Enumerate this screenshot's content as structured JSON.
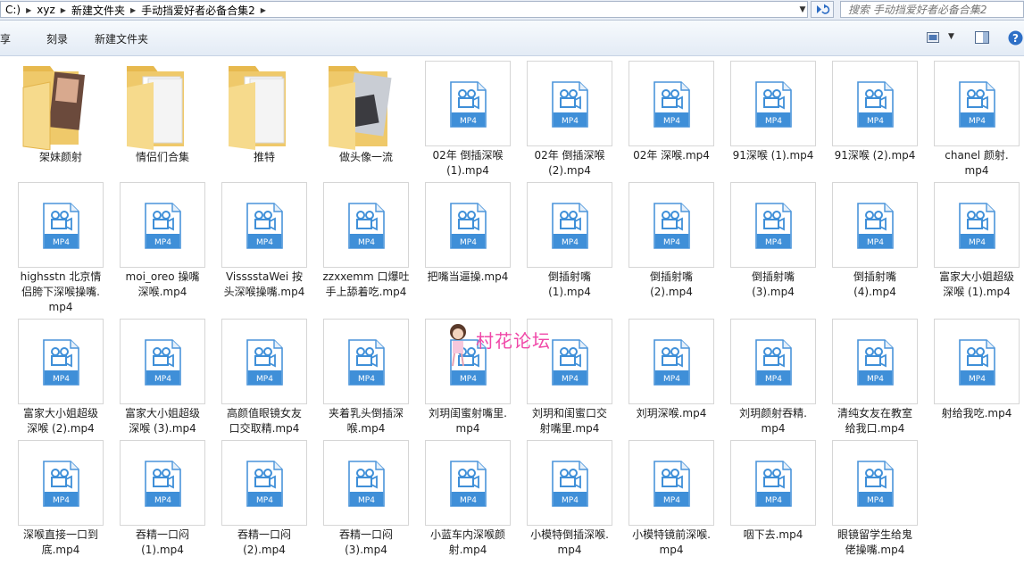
{
  "address": {
    "breadcrumbs": [
      "C:)",
      "xyz",
      "新建文件夹",
      "手动挡爱好者必备合集2"
    ],
    "search_placeholder": "搜索 手动挡爱好者必备合集2"
  },
  "toolbar": {
    "share_label": "享",
    "burn_label": "刻录",
    "new_folder_label": "新建文件夹"
  },
  "file_type_label": "MP4",
  "icons": {
    "refresh": "refresh-icon",
    "view": "view-options-icon",
    "preview_pane": "preview-pane-icon",
    "help": "help-icon",
    "video_file": "video-file-icon",
    "folder": "folder-icon"
  },
  "colors": {
    "mp4_icon_blue": "#3f8fd8",
    "folder_yellow": "#f4d27a",
    "watermark_pink": "#f048a8"
  },
  "folders": [
    {
      "name": "架妹颜射",
      "lines": [
        "架妹颜射"
      ]
    },
    {
      "name": "情侣们合集",
      "lines": [
        "情侣们合集"
      ]
    },
    {
      "name": "推特",
      "lines": [
        "推特"
      ]
    },
    {
      "name": "做头像一流",
      "lines": [
        "做头像一流"
      ]
    }
  ],
  "files_row1": [
    {
      "lines": [
        "02年 倒插深喉",
        "(1).mp4"
      ]
    },
    {
      "lines": [
        "02年 倒插深喉",
        "(2).mp4"
      ]
    },
    {
      "lines": [
        "02年 深喉.mp4"
      ]
    },
    {
      "lines": [
        "91深喉 (1).mp4"
      ]
    },
    {
      "lines": [
        "91深喉 (2).mp4"
      ]
    },
    {
      "lines": [
        "chanel 颜射.",
        "mp4"
      ]
    }
  ],
  "files_row2": [
    {
      "lines": [
        "highsstn 北京情",
        "侣胯下深喉操嘴.",
        "mp4"
      ]
    },
    {
      "lines": [
        "moi_oreo 操嘴",
        "深喉.mp4"
      ]
    },
    {
      "lines": [
        "VisssstaWei 按",
        "头深喉操嘴.mp4"
      ]
    },
    {
      "lines": [
        "zzxxemm 口爆吐",
        "手上舔着吃.mp4"
      ]
    },
    {
      "lines": [
        "把嘴当逼操.mp4"
      ]
    },
    {
      "lines": [
        "倒插射嘴",
        "(1).mp4"
      ]
    },
    {
      "lines": [
        "倒插射嘴",
        "(2).mp4"
      ]
    },
    {
      "lines": [
        "倒插射嘴",
        "(3).mp4"
      ]
    },
    {
      "lines": [
        "倒插射嘴",
        "(4).mp4"
      ]
    },
    {
      "lines": [
        "富家大小姐超级",
        "深喉 (1).mp4"
      ]
    }
  ],
  "files_row3": [
    {
      "lines": [
        "富家大小姐超级",
        "深喉 (2).mp4"
      ]
    },
    {
      "lines": [
        "富家大小姐超级",
        "深喉 (3).mp4"
      ]
    },
    {
      "lines": [
        "高颜值眼镜女友",
        "口交取精.mp4"
      ]
    },
    {
      "lines": [
        "夹着乳头倒插深",
        "喉.mp4"
      ]
    },
    {
      "lines": [
        "刘玥闺蜜射嘴里.",
        "mp4"
      ]
    },
    {
      "lines": [
        "刘玥和闺蜜口交",
        "射嘴里.mp4"
      ]
    },
    {
      "lines": [
        "刘玥深喉.mp4"
      ]
    },
    {
      "lines": [
        "刘玥颜射吞精.",
        "mp4"
      ]
    },
    {
      "lines": [
        "清纯女友在教室",
        "给我口.mp4"
      ]
    },
    {
      "lines": [
        "射给我吃.mp4"
      ]
    }
  ],
  "files_row4": [
    {
      "lines": [
        "深喉直接一口到",
        "底.mp4"
      ]
    },
    {
      "lines": [
        "吞精一口闷",
        "(1).mp4"
      ]
    },
    {
      "lines": [
        "吞精一口闷",
        "(2).mp4"
      ]
    },
    {
      "lines": [
        "吞精一口闷",
        "(3).mp4"
      ]
    },
    {
      "lines": [
        "小蓝车内深喉颜",
        "射.mp4"
      ]
    },
    {
      "lines": [
        "小模特倒插深喉.",
        "mp4"
      ]
    },
    {
      "lines": [
        "小模特镜前深喉.",
        "mp4"
      ]
    },
    {
      "lines": [
        "咽下去.mp4"
      ]
    },
    {
      "lines": [
        "眼镜留学生给鬼",
        "佬操嘴.mp4"
      ]
    }
  ],
  "watermark": {
    "text": "村花论坛"
  }
}
